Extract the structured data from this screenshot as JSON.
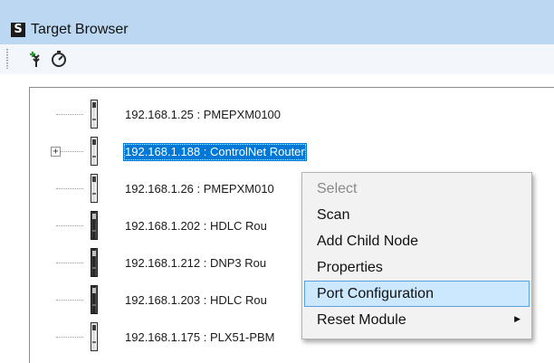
{
  "window": {
    "title": "Target Browser",
    "app_icon_glyph": "S",
    "app_icon_name": "app-logo-icon"
  },
  "toolbar": {
    "buttons": [
      {
        "icon": "add-device-icon",
        "label": ""
      },
      {
        "icon": "refresh-scan-icon",
        "label": ""
      }
    ]
  },
  "tree": {
    "expander_glyph": "+",
    "nodes": [
      {
        "label": "192.168.1.25 : PMEPXM0100",
        "selected": false,
        "expandable": false,
        "icon": "device-module-icon"
      },
      {
        "label": "192.168.1.188 : ControlNet Router",
        "selected": true,
        "expandable": true,
        "icon": "device-module-icon"
      },
      {
        "label": "192.168.1.26 : PMEPXM010",
        "selected": false,
        "expandable": false,
        "icon": "device-module-icon"
      },
      {
        "label": "192.168.1.202 : HDLC Rou",
        "selected": false,
        "expandable": false,
        "icon": "device-module-icon"
      },
      {
        "label": "192.168.1.212 : DNP3 Rou",
        "selected": false,
        "expandable": false,
        "icon": "device-module-icon"
      },
      {
        "label": "192.168.1.203 : HDLC Rou",
        "selected": false,
        "expandable": false,
        "icon": "device-module-icon"
      },
      {
        "label": "192.168.1.175 : PLX51-PBM",
        "selected": false,
        "expandable": false,
        "icon": "device-module-icon"
      }
    ]
  },
  "context_menu": {
    "items": [
      {
        "label": "Select",
        "disabled": true,
        "highlighted": false,
        "submenu": false
      },
      {
        "label": "Scan",
        "disabled": false,
        "highlighted": false,
        "submenu": false
      },
      {
        "label": "Add Child Node",
        "disabled": false,
        "highlighted": false,
        "submenu": false
      },
      {
        "label": "Properties",
        "disabled": false,
        "highlighted": false,
        "submenu": false
      },
      {
        "label": "Port Configuration",
        "disabled": false,
        "highlighted": true,
        "submenu": false
      },
      {
        "label": "Reset Module",
        "disabled": false,
        "highlighted": false,
        "submenu": true
      }
    ],
    "submenu_arrow_glyph": "▶"
  },
  "colors": {
    "titlebar_bg": "#bcd7f1",
    "selection_bg": "#0078d7",
    "menu_highlight_bg": "#cce8ff",
    "menu_highlight_border": "#5aa0dc"
  }
}
